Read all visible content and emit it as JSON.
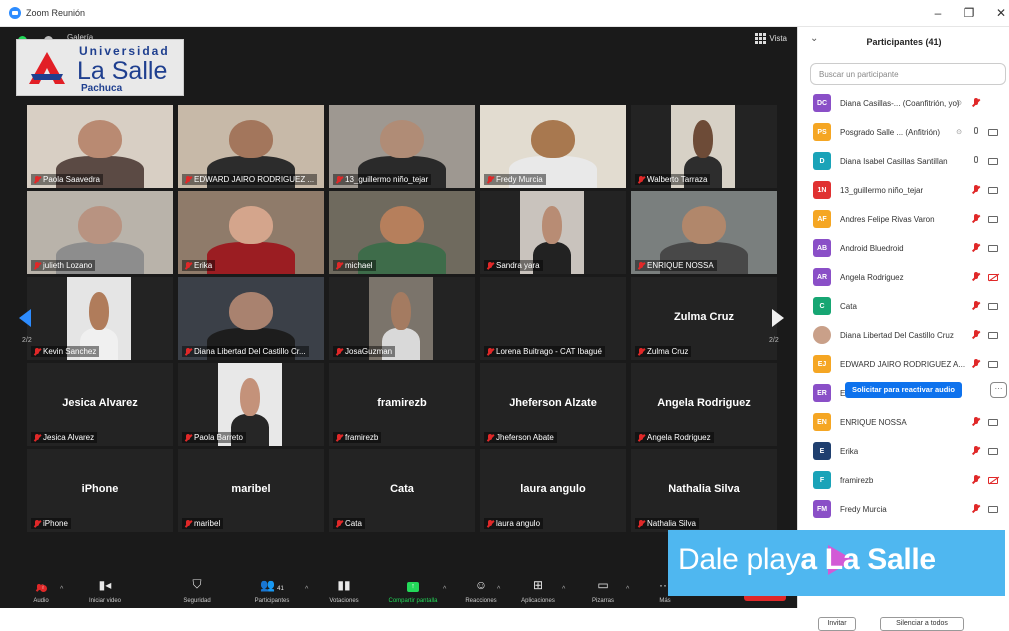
{
  "window": {
    "title": "Zoom Reunión",
    "minimize": "–",
    "maximize": "❐",
    "close": "✕"
  },
  "meeting_top": {
    "gallery_label": "Galería",
    "view_label": "Vista"
  },
  "logo": {
    "line1": "Universidad",
    "line2": "La Salle",
    "line3": "Pachuca",
    "colors": {
      "red": "#e21f26",
      "blue": "#1f3f8f"
    }
  },
  "tiles": [
    {
      "label": "Paola Saavedra",
      "video": true,
      "bg": "#d8cfc4",
      "face": "#b98a72",
      "body": "#5b4a44"
    },
    {
      "label": "EDWARD JAIRO RODRIGUEZ ...",
      "video": true,
      "bg": "#c7b9a8",
      "face": "#a3765c",
      "body": "#2c2c2c"
    },
    {
      "label": "13_guillermo niño_tejar",
      "video": true,
      "bg": "#9e9891",
      "face": "#b08c76",
      "body": "#2a2a2a"
    },
    {
      "label": "Fredy Murcia",
      "video": true,
      "bg": "#e2dcd0",
      "face": "#a8784f",
      "body": "#e9e9e9"
    },
    {
      "label": "Walberto Tarraza",
      "video": true,
      "bg": "#d7d1c6",
      "face": "#6d4b37",
      "body": "#2d2d2d",
      "inset": true
    },
    {
      "label": "julieth Lozano",
      "video": true,
      "bg": "#b9b3aa",
      "face": "#b89381",
      "body": "#8d8d8d"
    },
    {
      "label": "Erika",
      "video": true,
      "bg": "#8f7b6a",
      "face": "#d4a58c",
      "body": "#9b1d22"
    },
    {
      "label": "michael",
      "video": true,
      "bg": "#6f6a5e",
      "face": "#b67f5c",
      "body": "#3e6c4a"
    },
    {
      "label": "Sandra yara",
      "video": true,
      "bg": "#c9c3bd",
      "face": "#b88c74",
      "body": "#222222",
      "inset": true
    },
    {
      "label": "ENRIQUE NOSSA",
      "video": true,
      "bg": "#7a7f7e",
      "face": "#b1876b",
      "body": "#484848"
    },
    {
      "label": "Kevin Sanchez",
      "video": true,
      "bg": "#e5e5e5",
      "face": "#b07c5b",
      "body": "#f0f0f0",
      "inset": true
    },
    {
      "label": "Diana Libertad Del Castillo Cr...",
      "video": true,
      "bg": "#3b4048",
      "face": "#a9826f",
      "body": "#1d1d1d"
    },
    {
      "label": "JosaGuzman",
      "video": true,
      "bg": "#7b746b",
      "face": "#a47b61",
      "body": "#d9d9d9",
      "inset": true
    },
    {
      "label": "Lorena Buitrago - CAT Ibagué",
      "video": false,
      "big": ""
    },
    {
      "label": "Zulma Cruz",
      "video": false,
      "big": "Zulma Cruz"
    },
    {
      "label": "Jesica Alvarez",
      "video": false,
      "big": "Jesica Alvarez"
    },
    {
      "label": "Paola Barreto",
      "video": true,
      "bg": "#e8e8e8",
      "face": "#c4927a",
      "body": "#262626",
      "inset": true
    },
    {
      "label": "framirezb",
      "video": false,
      "big": "framirezb"
    },
    {
      "label": "Jheferson Abate",
      "video": false,
      "big": "Jheferson Alzate"
    },
    {
      "label": "Angela Rodriguez",
      "video": false,
      "big": "Angela Rodriguez"
    },
    {
      "label": "iPhone",
      "video": false,
      "big": "iPhone"
    },
    {
      "label": "maribel",
      "video": false,
      "big": "maribel"
    },
    {
      "label": "Cata",
      "video": false,
      "big": "Cata"
    },
    {
      "label": "laura angulo",
      "video": false,
      "big": "laura angulo"
    },
    {
      "label": "Nathalia Silva",
      "video": false,
      "big": "Nathalia Silva"
    }
  ],
  "pager": {
    "left": "2/2",
    "right": "2/2"
  },
  "toolbar": {
    "audio": "Audio",
    "video": "Iniciar video",
    "security": "Seguridad",
    "participants": "Participantes",
    "participants_count": "41",
    "polls": "Votaciones",
    "share": "Compartir pantalla",
    "reactions": "Reacciones",
    "apps": "Aplicaciones",
    "whiteboard": "Pizarras",
    "more": "Más",
    "end": "Salir",
    "audio_badge": "!"
  },
  "panel": {
    "title": "Participantes (41)",
    "search_placeholder": "Buscar un participante",
    "participants": [
      {
        "initials": "DC",
        "color": "#8a4fc7",
        "name": "Diana Casillas-... (Coanfitrión, yo)",
        "mic": "muted",
        "cam": "none",
        "host": true
      },
      {
        "initials": "PS",
        "color": "#f5a623",
        "name": "Posgrado Salle ... (Anfitrión)",
        "mic": "on",
        "cam": "on",
        "host": true
      },
      {
        "initials": "D",
        "color": "#1aa3b8",
        "name": "Diana Isabel Casillas Santillan",
        "mic": "on",
        "cam": "on"
      },
      {
        "initials": "1N",
        "color": "#e03131",
        "name": "13_guillermo niño_tejar",
        "mic": "muted",
        "cam": "on"
      },
      {
        "initials": "AF",
        "color": "#f5a623",
        "name": "Andres Felipe Rivas Varon",
        "mic": "muted",
        "cam": "on"
      },
      {
        "initials": "AB",
        "color": "#8a4fc7",
        "name": "Android Bluedroid",
        "mic": "muted",
        "cam": "on"
      },
      {
        "initials": "AR",
        "color": "#8a4fc7",
        "name": "Angela Rodriguez",
        "mic": "muted",
        "cam": "off"
      },
      {
        "initials": "C",
        "color": "#17a673",
        "name": "Cata",
        "mic": "muted",
        "cam": "on"
      },
      {
        "initials": "",
        "color": "#c9a089",
        "name": "Diana Libertad Del Castillo Cruz",
        "mic": "muted",
        "cam": "on",
        "photo": true
      },
      {
        "initials": "EJ",
        "color": "#f5a623",
        "name": "EDWARD JAIRO RODRIGUEZ A...",
        "mic": "muted",
        "cam": "on"
      },
      {
        "initials": "ER",
        "color": "#8a4fc7",
        "name": "E",
        "mic": "none",
        "cam": "none"
      },
      {
        "initials": "EN",
        "color": "#f5a623",
        "name": "ENRIQUE NOSSA",
        "mic": "muted",
        "cam": "on"
      },
      {
        "initials": "E",
        "color": "#1f3f6f",
        "name": "Erika",
        "mic": "muted",
        "cam": "on"
      },
      {
        "initials": "F",
        "color": "#1aa3b8",
        "name": "framirezb",
        "mic": "muted",
        "cam": "off"
      },
      {
        "initials": "FM",
        "color": "#8a4fc7",
        "name": "Fredy Murcia",
        "mic": "muted",
        "cam": "on"
      }
    ],
    "request_unmute": "Solicitar para reactivar audio",
    "more_button": "···",
    "invite": "Invitar",
    "mute_all": "Silenciar a todos"
  },
  "banner": {
    "text_light": "Dale play",
    "text_bold": "a La Salle",
    "color": "#4fb7f0"
  }
}
